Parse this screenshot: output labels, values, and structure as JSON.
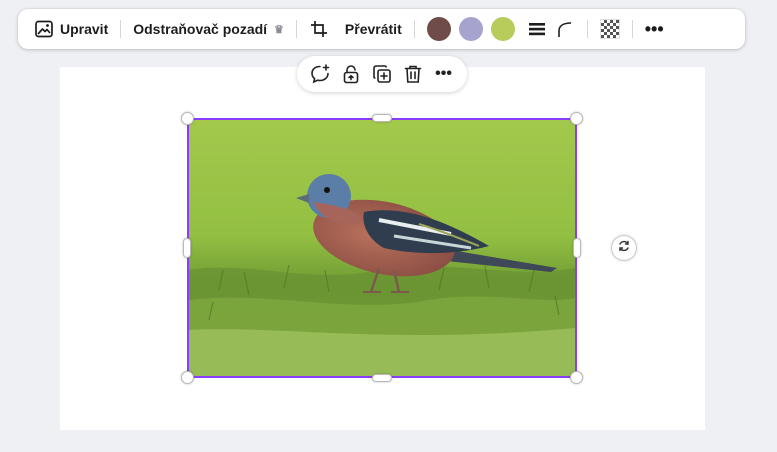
{
  "toolbar": {
    "edit_label": "Upravit",
    "bg_remover_label": "Odstraňovač pozadí",
    "flip_label": "Převrátit",
    "colors": [
      "#6f4c4a",
      "#a6a3cf",
      "#b7cc5b"
    ],
    "icons": {
      "edit": "image-edit-icon",
      "premium": "crown-icon",
      "crop": "crop-icon",
      "border": "line-weight-icon",
      "corner": "corner-rounding-icon",
      "transparency": "transparency-icon",
      "more": "more-icon"
    }
  },
  "floating_bar": {
    "icons": [
      "ai-comment-icon",
      "lock-icon",
      "duplicate-icon",
      "trash-icon",
      "more-icon"
    ]
  },
  "selection": {
    "accent": "#8b3dff",
    "image_subject": "bird"
  },
  "rotate": {
    "icon": "rotate-icon"
  }
}
